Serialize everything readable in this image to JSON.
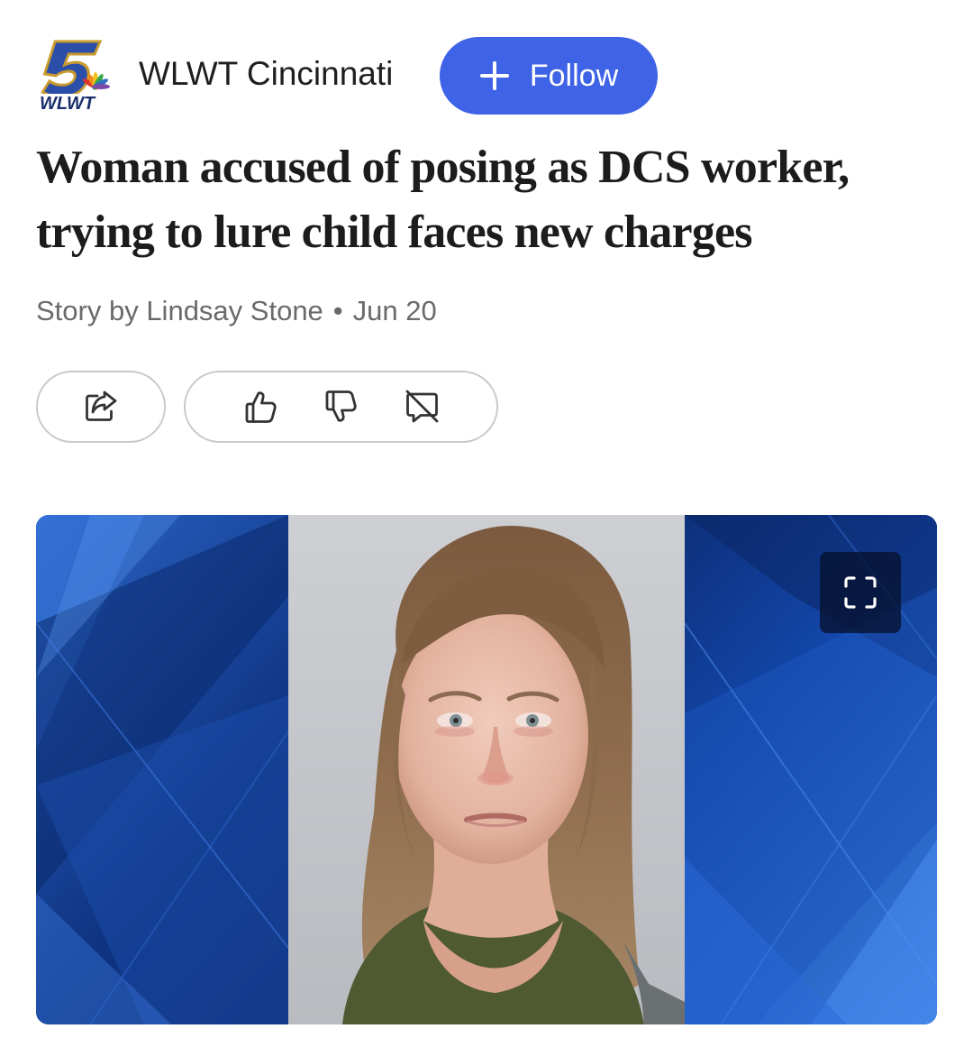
{
  "source": {
    "name": "WLWT Cincinnati",
    "logo_text": "WLWT",
    "logo_number": "5",
    "logo_icon": "nbc-peacock-icon"
  },
  "follow_button": {
    "label": "Follow",
    "icon": "plus-icon",
    "color": "#3f63e6"
  },
  "article": {
    "headline": "Woman accused of posing as DCS worker, trying to lure child faces new charges",
    "byline_author": "Story by Lindsay Stone",
    "byline_separator": "•",
    "byline_date": "Jun 20"
  },
  "actions": {
    "share": "share-icon",
    "like": "thumbs-up-icon",
    "dislike": "thumbs-down-icon",
    "comments": "comments-off-icon"
  },
  "hero_image": {
    "background_color": "#0d2a66",
    "expand_icon": "expand-icon"
  }
}
